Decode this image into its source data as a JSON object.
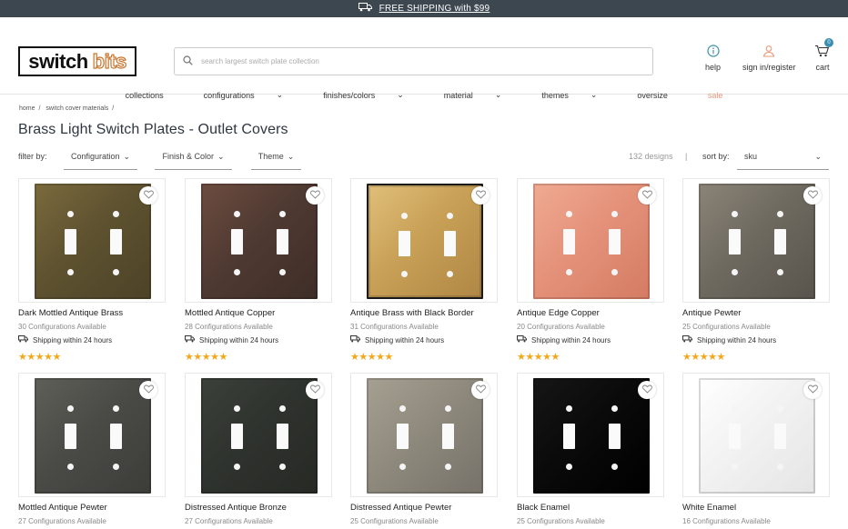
{
  "topbar": {
    "text": "FREE SHIPPING with $99",
    "icon": "truck-icon"
  },
  "logo": {
    "word1": "switch",
    "word2": "bits"
  },
  "search": {
    "placeholder": "search largest switch plate collection"
  },
  "header_icons": {
    "help": "help",
    "account": "sign in/register",
    "cart": "cart",
    "cart_count": "0"
  },
  "nav": [
    "collections",
    "configurations",
    "finishes/colors",
    "material",
    "themes",
    "oversize",
    "sale"
  ],
  "breadcrumbs": [
    "home",
    "switch cover materials"
  ],
  "page_title": "Brass Light Switch Plates - Outlet Covers",
  "filters": {
    "label": "filter by:",
    "options": [
      "Configuration",
      "Finish & Color",
      "Theme"
    ],
    "count": "132 designs",
    "separator": "|",
    "sort_label": "sort by:",
    "sort_value": "sku"
  },
  "colors": {
    "accent": "#f3a81c",
    "sale": "#e8987c",
    "topbar": "#3d4750"
  },
  "products": [
    {
      "name": "Dark Mottled Antique Brass",
      "configs": "30 Configurations Available",
      "ship": "Shipping within 24 hours",
      "stars": "★★★★★",
      "finish": [
        "#5e5230",
        "#7a6a3c",
        "#4c4226"
      ]
    },
    {
      "name": "Mottled Antique Copper",
      "configs": "28 Configurations Available",
      "ship": "Shipping within 24 hours",
      "stars": "★★★★★",
      "finish": [
        "#4f3a32",
        "#6d4c40",
        "#3e2d27"
      ]
    },
    {
      "name": "Antique Brass with Black Border",
      "configs": "31 Configurations Available",
      "ship": "Shipping within 24 hours",
      "stars": "★★★★★",
      "finish": [
        "#c8a056",
        "#e0bf7a",
        "#b08745"
      ]
    },
    {
      "name": "Antique Edge Copper",
      "configs": "20 Configurations Available",
      "ship": "Shipping within 24 hours",
      "stars": "★★★★★",
      "finish": [
        "#e5927a",
        "#f0aa92",
        "#d47b63"
      ]
    },
    {
      "name": "Antique Pewter",
      "configs": "25 Configurations Available",
      "ship": "Shipping within 24 hours",
      "stars": "★★★★★",
      "finish": [
        "#6f6a60",
        "#8a8478",
        "#58544c"
      ]
    },
    {
      "name": "Mottled Antique Pewter",
      "configs": "27 Configurations Available",
      "ship": "",
      "stars": "",
      "finish": [
        "#4a4b46",
        "#5e5f59",
        "#3c3d39"
      ]
    },
    {
      "name": "Distressed Antique Bronze",
      "configs": "27 Configurations Available",
      "ship": "",
      "stars": "",
      "finish": [
        "#2f332e",
        "#3b403a",
        "#262924"
      ]
    },
    {
      "name": "Distressed Antique Pewter",
      "configs": "25 Configurations Available",
      "ship": "",
      "stars": "",
      "finish": [
        "#8f8a7d",
        "#a6a092",
        "#77726a"
      ]
    },
    {
      "name": "Black Enamel",
      "configs": "25 Configurations Available",
      "ship": "",
      "stars": "",
      "finish": [
        "#0a0a0a",
        "#161616",
        "#000000"
      ]
    },
    {
      "name": "White Enamel",
      "configs": "16 Configurations Available",
      "ship": "",
      "stars": "",
      "finish": [
        "#f2f2f2",
        "#ffffff",
        "#e5e5e5"
      ]
    }
  ]
}
